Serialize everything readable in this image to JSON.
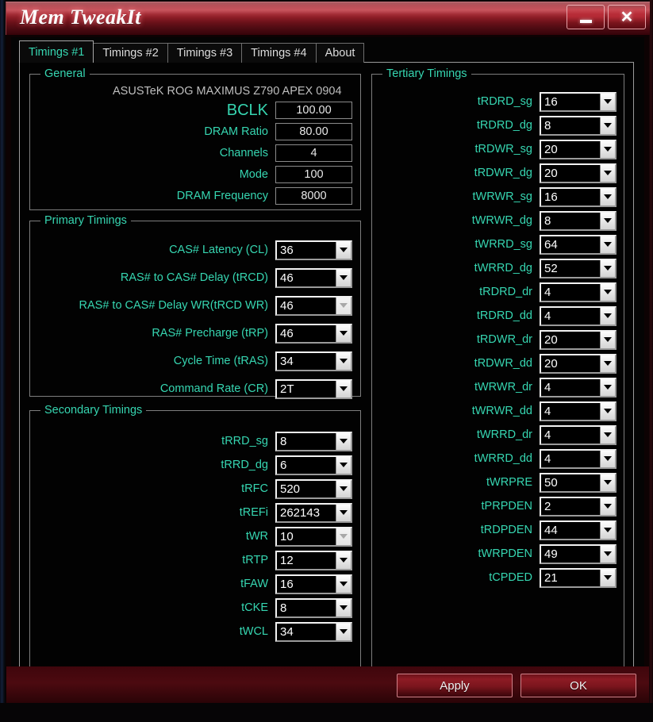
{
  "window": {
    "title": "Mem TweakIt",
    "minimize_label": "–",
    "close_label": "✕"
  },
  "tabs": [
    {
      "label": "Timings #1",
      "active": true
    },
    {
      "label": "Timings #2",
      "active": false
    },
    {
      "label": "Timings #3",
      "active": false
    },
    {
      "label": "Timings #4",
      "active": false
    },
    {
      "label": "About",
      "active": false
    }
  ],
  "general": {
    "title": "General",
    "motherboard": "ASUSTeK ROG MAXIMUS Z790 APEX 0904",
    "fields": [
      {
        "label": "BCLK",
        "value": "100.00",
        "big": true
      },
      {
        "label": "DRAM Ratio",
        "value": "80.00",
        "big": false
      },
      {
        "label": "Channels",
        "value": "4",
        "big": false
      },
      {
        "label": "Mode",
        "value": "100",
        "big": false
      },
      {
        "label": "DRAM Frequency",
        "value": "8000",
        "big": false
      }
    ]
  },
  "primary": {
    "title": "Primary Timings",
    "fields": [
      {
        "label": "CAS# Latency (CL)",
        "value": "36",
        "disabled": false
      },
      {
        "label": "RAS# to CAS# Delay (tRCD)",
        "value": "46",
        "disabled": false
      },
      {
        "label": "RAS# to CAS# Delay WR(tRCD WR)",
        "value": "46",
        "disabled": true
      },
      {
        "label": "RAS# Precharge (tRP)",
        "value": "46",
        "disabled": false
      },
      {
        "label": "Cycle Time (tRAS)",
        "value": "34",
        "disabled": false
      },
      {
        "label": "Command Rate (CR)",
        "value": "2T",
        "disabled": false
      }
    ]
  },
  "secondary": {
    "title": "Secondary Timings",
    "fields": [
      {
        "label": "tRRD_sg",
        "value": "8",
        "disabled": false
      },
      {
        "label": "tRRD_dg",
        "value": "6",
        "disabled": false
      },
      {
        "label": "tRFC",
        "value": "520",
        "disabled": false
      },
      {
        "label": "tREFi",
        "value": "262143",
        "disabled": false
      },
      {
        "label": "tWR",
        "value": "10",
        "disabled": true
      },
      {
        "label": "tRTP",
        "value": "12",
        "disabled": false
      },
      {
        "label": "tFAW",
        "value": "16",
        "disabled": false
      },
      {
        "label": "tCKE",
        "value": "8",
        "disabled": false
      },
      {
        "label": "tWCL",
        "value": "34",
        "disabled": false
      }
    ]
  },
  "tertiary": {
    "title": "Tertiary Timings",
    "fields": [
      {
        "label": "tRDRD_sg",
        "value": "16",
        "disabled": false
      },
      {
        "label": "tRDRD_dg",
        "value": "8",
        "disabled": false
      },
      {
        "label": "tRDWR_sg",
        "value": "20",
        "disabled": false
      },
      {
        "label": "tRDWR_dg",
        "value": "20",
        "disabled": false
      },
      {
        "label": "tWRWR_sg",
        "value": "16",
        "disabled": false
      },
      {
        "label": "tWRWR_dg",
        "value": "8",
        "disabled": false
      },
      {
        "label": "tWRRD_sg",
        "value": "64",
        "disabled": false
      },
      {
        "label": "tWRRD_dg",
        "value": "52",
        "disabled": false
      },
      {
        "label": "tRDRD_dr",
        "value": "4",
        "disabled": false
      },
      {
        "label": "tRDRD_dd",
        "value": "4",
        "disabled": false
      },
      {
        "label": "tRDWR_dr",
        "value": "20",
        "disabled": false
      },
      {
        "label": "tRDWR_dd",
        "value": "20",
        "disabled": false
      },
      {
        "label": "tWRWR_dr",
        "value": "4",
        "disabled": false
      },
      {
        "label": "tWRWR_dd",
        "value": "4",
        "disabled": false
      },
      {
        "label": "tWRRD_dr",
        "value": "4",
        "disabled": false
      },
      {
        "label": "tWRRD_dd",
        "value": "4",
        "disabled": false
      },
      {
        "label": "tWRPRE",
        "value": "50",
        "disabled": false
      },
      {
        "label": "tPRPDEN",
        "value": "2",
        "disabled": false
      },
      {
        "label": "tRDPDEN",
        "value": "44",
        "disabled": false
      },
      {
        "label": "tWRPDEN",
        "value": "49",
        "disabled": false
      },
      {
        "label": "tCPDED",
        "value": "21",
        "disabled": false
      }
    ]
  },
  "footer": {
    "apply_label": "Apply",
    "ok_label": "OK"
  },
  "colors": {
    "accent_teal": "#36d6b1",
    "title_red": "#a3242f",
    "button_red": "#8d1b24"
  }
}
